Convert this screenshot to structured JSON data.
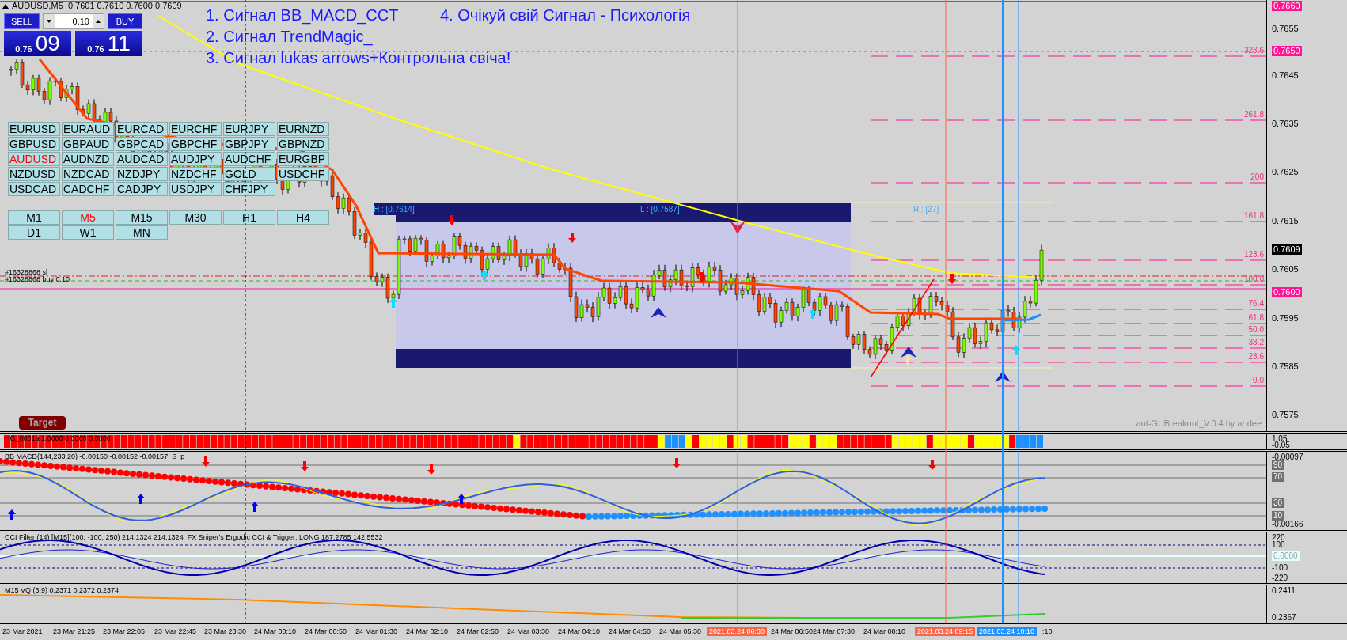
{
  "window": {
    "symbol_line": "AUDUSD,M5  0.7601 0.7610 0.7600 0.7609"
  },
  "trade_panel": {
    "sell_label": "SELL",
    "buy_label": "BUY",
    "lot": "0.10",
    "bid_prefix": "0.76",
    "bid_digits": "09",
    "ask_prefix": "0.76",
    "ask_digits": "11"
  },
  "signals": [
    "1. Сигнал BB_MACD_CCT",
    "2. Сигнал TrendMagic_",
    "3. Сигнал lukas arrows+Контрольна свіча!",
    "4. Очікуй свій Сигнал - Психологія"
  ],
  "symbols": [
    {
      "label": "EURUSD",
      "selected": false
    },
    {
      "label": "EURAUD",
      "selected": false
    },
    {
      "label": "EURCAD",
      "selected": false
    },
    {
      "label": "EURCHF",
      "selected": false
    },
    {
      "label": "EURJPY",
      "selected": false
    },
    {
      "label": "EURNZD",
      "selected": false
    },
    {
      "label": "GBPUSD",
      "selected": false
    },
    {
      "label": "GBPAUD",
      "selected": false
    },
    {
      "label": "GBPCAD",
      "selected": false
    },
    {
      "label": "GBPCHF",
      "selected": false
    },
    {
      "label": "GBPJPY",
      "selected": false
    },
    {
      "label": "GBPNZD",
      "selected": false
    },
    {
      "label": "AUDUSD",
      "selected": true
    },
    {
      "label": "AUDNZD",
      "selected": false
    },
    {
      "label": "AUDCAD",
      "selected": false
    },
    {
      "label": "AUDJPY",
      "selected": false
    },
    {
      "label": "AUDCHF",
      "selected": false
    },
    {
      "label": "EURGBP",
      "selected": false
    },
    {
      "label": "NZDUSD",
      "selected": false
    },
    {
      "label": "NZDCAD",
      "selected": false
    },
    {
      "label": "NZDJPY",
      "selected": false
    },
    {
      "label": "NZDCHF",
      "selected": false
    },
    {
      "label": "GOLD",
      "selected": false
    },
    {
      "label": "USDCHF",
      "selected": false
    },
    {
      "label": "USDCAD",
      "selected": false
    },
    {
      "label": "CADCHF",
      "selected": false
    },
    {
      "label": "CADJPY",
      "selected": false
    },
    {
      "label": "USDJPY",
      "selected": false
    },
    {
      "label": "CHFJPY",
      "selected": false
    }
  ],
  "timeframes": [
    {
      "label": "M1",
      "selected": false
    },
    {
      "label": "M5",
      "selected": true
    },
    {
      "label": "M15",
      "selected": false
    },
    {
      "label": "M30",
      "selected": false
    },
    {
      "label": "H1",
      "selected": false
    },
    {
      "label": "H4",
      "selected": false
    },
    {
      "label": "D1",
      "selected": false
    },
    {
      "label": "W1",
      "selected": false
    },
    {
      "label": "MN",
      "selected": false
    }
  ],
  "order_labels": [
    "#16328868 sl",
    "#16328868 buy 0.10"
  ],
  "breakout_box": {
    "high_label": "H : [0.7614]",
    "low_label": "L : [0.7587]",
    "range_label": "R : [27]"
  },
  "fib_levels": [
    "323.6",
    "261.8",
    "200",
    "161.8",
    "123.6",
    "100.0",
    "76.4",
    "61.8",
    "50.0",
    "38.2",
    "23.6",
    "0.0"
  ],
  "price_axis": [
    {
      "text": "0.7660",
      "kind": "marker"
    },
    {
      "text": "0.7655",
      "kind": "plain"
    },
    {
      "text": "0.7650",
      "kind": "marker"
    },
    {
      "text": "0.7645",
      "kind": "plain"
    },
    {
      "text": "0.7635",
      "kind": "plain"
    },
    {
      "text": "0.7625",
      "kind": "plain"
    },
    {
      "text": "0.7615",
      "kind": "plain"
    },
    {
      "text": "0.7609",
      "kind": "current"
    },
    {
      "text": "0.7605",
      "kind": "plain"
    },
    {
      "text": "0.7600",
      "kind": "marker"
    },
    {
      "text": "0.7595",
      "kind": "plain"
    },
    {
      "text": "0.7585",
      "kind": "plain"
    },
    {
      "text": "0.7575",
      "kind": "plain"
    }
  ],
  "indicator_credit": "ant-GUBreakout_V.0.4 by andee",
  "target_button": "Target",
  "panes": [
    {
      "kind": "histogram",
      "title": "HG_0001a 1.0000 0.0000 0.0000",
      "axis": [
        {
          "text": "1.05",
          "kind": "value"
        },
        {
          "text": "-0.05",
          "kind": "value"
        }
      ]
    },
    {
      "kind": "macd",
      "title": "BB MACD(144,233,20) -0.00150 -0.00152 -0.00157  S_p",
      "axis": [
        {
          "text": "-0.00097",
          "kind": "value"
        },
        {
          "text": "90",
          "kind": "level"
        },
        {
          "text": "70",
          "kind": "level"
        },
        {
          "text": "30",
          "kind": "level"
        },
        {
          "text": "10",
          "kind": "level"
        },
        {
          "text": "-0.00166",
          "kind": "value"
        }
      ]
    },
    {
      "kind": "cci",
      "title": "CCI Filter (14) [M15](100, -100, 250) 214.1324 214.1324  FX Sniper's Ergodic CCI & Trigger: LONG 187.2785 142.5532",
      "axis": [
        {
          "text": "220",
          "kind": "value"
        },
        {
          "text": "100",
          "kind": "value"
        },
        {
          "text": "0.0000",
          "kind": "marker"
        },
        {
          "text": "-100",
          "kind": "value"
        },
        {
          "text": "-220",
          "kind": "value"
        }
      ]
    },
    {
      "kind": "vq",
      "title": "M15 VQ (3,9) 0.2371 0.2372 0.2374",
      "axis": [
        {
          "text": "0.2411",
          "kind": "value"
        },
        {
          "text": "0.2367",
          "kind": "value"
        }
      ]
    }
  ],
  "time_axis": [
    {
      "text": "23 Mar 2021",
      "kind": "plain"
    },
    {
      "text": "23 Mar 21:25",
      "kind": "plain"
    },
    {
      "text": "23 Mar 22:05",
      "kind": "plain"
    },
    {
      "text": "23 Mar 22:45",
      "kind": "plain"
    },
    {
      "text": "23 Mar 23:30",
      "kind": "plain"
    },
    {
      "text": "24 Mar 00:10",
      "kind": "plain"
    },
    {
      "text": "24 Mar 00:50",
      "kind": "plain"
    },
    {
      "text": "24 Mar 01:30",
      "kind": "plain"
    },
    {
      "text": "24 Mar 02:10",
      "kind": "plain"
    },
    {
      "text": "24 Mar 02:50",
      "kind": "plain"
    },
    {
      "text": "24 Mar 03:30",
      "kind": "plain"
    },
    {
      "text": "24 Mar 04:10",
      "kind": "plain"
    },
    {
      "text": "24 Mar 04:50",
      "kind": "plain"
    },
    {
      "text": "24 Mar 05:30",
      "kind": "plain"
    },
    {
      "text": "2021.03.24 06:30",
      "kind": "red"
    },
    {
      "text": "24 Mar 06:50",
      "kind": "plain"
    },
    {
      "text": "24 Mar 07:30",
      "kind": "plain"
    },
    {
      "text": "24 Mar 08:10",
      "kind": "plain"
    },
    {
      "text": "2021.03.24 09:15",
      "kind": "red"
    },
    {
      "text": "2021.03.24 10:10",
      "kind": "blue"
    },
    {
      "text": ":10",
      "kind": "plain"
    }
  ]
}
